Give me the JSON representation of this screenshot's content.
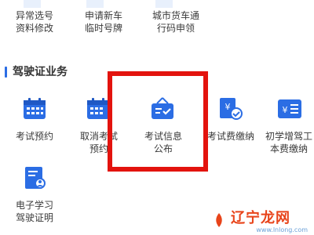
{
  "top_row": [
    {
      "label": "异常选号\n资料修改"
    },
    {
      "label": "申请新车\n临时号牌"
    },
    {
      "label": "城市货车通\n行码申领"
    }
  ],
  "section": {
    "title": "驾驶证业务"
  },
  "services": [
    {
      "label": "考试预约",
      "icon": "calendar-icon"
    },
    {
      "label": "取消考试\n预约",
      "icon": "calendar-cancel-icon"
    },
    {
      "label": "考试信息\n公布",
      "icon": "notice-board-icon"
    },
    {
      "label": "考试费缴纳",
      "icon": "fee-receipt-icon"
    },
    {
      "label": "初学增驾工\n本费缴纳",
      "icon": "payment-card-icon"
    }
  ],
  "services_row2": [
    {
      "label": "电子学习\n驾驶证明",
      "icon": "document-user-icon"
    }
  ],
  "watermark": {
    "text": "辽宁龙网",
    "url": "www.lnlong.com"
  },
  "colors": {
    "primary": "#2b6de4",
    "highlight": "#e3130e"
  }
}
